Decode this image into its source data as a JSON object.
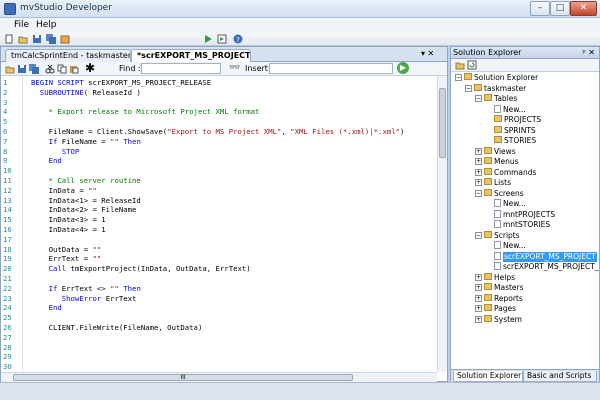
{
  "app": {
    "title": "mvStudio Developer"
  },
  "window_controls": {
    "minimize": "–",
    "maximize": "□",
    "close": "✕"
  },
  "menu": {
    "items": [
      "File",
      "Help"
    ]
  },
  "main_toolbar": {
    "icons": [
      "new-icon",
      "open-icon",
      "save-icon",
      "save-all-icon",
      "deploy-icon",
      "run-icon",
      "debug-icon",
      "help-icon"
    ]
  },
  "document": {
    "tabs": [
      {
        "label": "tmCalcSprintEnd - taskmaster.bp"
      },
      {
        "label": "*scrEXPORT_MS_PROJECT_REL..."
      }
    ],
    "tab_controls": "▾ ✕",
    "toolbar": {
      "find_label": "Find :",
      "insert_label": "Insert :"
    },
    "code_lines": [
      {
        "n": "1",
        "parts": [
          {
            "t": "kw",
            "v": "BEGIN SCRIPT"
          },
          {
            "t": "nm",
            "v": " scrEXPORT_MS_PROJECT_RELEASE"
          }
        ]
      },
      {
        "n": "2",
        "parts": [
          {
            "t": "nm",
            "v": "  "
          },
          {
            "t": "kw",
            "v": "SUBROUTINE"
          },
          {
            "t": "nm",
            "v": "( ReleaseId )"
          }
        ]
      },
      {
        "n": "3",
        "parts": []
      },
      {
        "n": "4",
        "parts": [
          {
            "t": "cm",
            "v": "    * Export release to Microsoft Project XML format"
          }
        ]
      },
      {
        "n": "5",
        "parts": []
      },
      {
        "n": "6",
        "parts": [
          {
            "t": "nm",
            "v": "    FileName = Client.ShowSave("
          },
          {
            "t": "st",
            "v": "\"Export to MS Project XML\""
          },
          {
            "t": "nm",
            "v": ", "
          },
          {
            "t": "st",
            "v": "\"XML Files (*.xml)|*.xml\""
          },
          {
            "t": "nm",
            "v": ")"
          }
        ]
      },
      {
        "n": "7",
        "parts": [
          {
            "t": "kw",
            "v": "    If"
          },
          {
            "t": "nm",
            "v": " FileName = "
          },
          {
            "t": "st",
            "v": "\"\""
          },
          {
            "t": "kw",
            "v": " Then"
          }
        ]
      },
      {
        "n": "8",
        "parts": [
          {
            "t": "kw",
            "v": "       STOP"
          }
        ]
      },
      {
        "n": "9",
        "parts": [
          {
            "t": "kw",
            "v": "    End"
          }
        ]
      },
      {
        "n": "10",
        "parts": []
      },
      {
        "n": "11",
        "parts": [
          {
            "t": "cm",
            "v": "    * Call server routine"
          }
        ]
      },
      {
        "n": "12",
        "parts": [
          {
            "t": "nm",
            "v": "    InData = "
          },
          {
            "t": "st",
            "v": "\"\""
          }
        ]
      },
      {
        "n": "13",
        "parts": [
          {
            "t": "nm",
            "v": "    InData<1> = ReleaseId"
          }
        ]
      },
      {
        "n": "14",
        "parts": [
          {
            "t": "nm",
            "v": "    InData<2> = FileName"
          }
        ]
      },
      {
        "n": "15",
        "parts": [
          {
            "t": "nm",
            "v": "    InData<3> = 1"
          }
        ]
      },
      {
        "n": "16",
        "parts": [
          {
            "t": "nm",
            "v": "    InData<4> = 1"
          }
        ]
      },
      {
        "n": "17",
        "parts": []
      },
      {
        "n": "18",
        "parts": [
          {
            "t": "nm",
            "v": "    OutData = "
          },
          {
            "t": "st",
            "v": "\"\""
          }
        ]
      },
      {
        "n": "19",
        "parts": [
          {
            "t": "nm",
            "v": "    ErrText = "
          },
          {
            "t": "st",
            "v": "\"\""
          }
        ]
      },
      {
        "n": "20",
        "parts": [
          {
            "t": "kw",
            "v": "    Call"
          },
          {
            "t": "nm",
            "v": " tmExportProject(InData, OutData, ErrText)"
          }
        ]
      },
      {
        "n": "21",
        "parts": []
      },
      {
        "n": "22",
        "parts": [
          {
            "t": "kw",
            "v": "    If"
          },
          {
            "t": "nm",
            "v": " ErrText <> "
          },
          {
            "t": "st",
            "v": "\"\""
          },
          {
            "t": "kw",
            "v": " Then"
          }
        ]
      },
      {
        "n": "23",
        "parts": [
          {
            "t": "kw",
            "v": "       ShowError"
          },
          {
            "t": "nm",
            "v": " ErrText"
          }
        ]
      },
      {
        "n": "24",
        "parts": [
          {
            "t": "kw",
            "v": "    End"
          }
        ]
      },
      {
        "n": "25",
        "parts": []
      },
      {
        "n": "26",
        "parts": [
          {
            "t": "nm",
            "v": "    CLIENT.FileWrite(FileName, OutData)"
          }
        ]
      },
      {
        "n": "27",
        "parts": []
      },
      {
        "n": "28",
        "parts": []
      },
      {
        "n": "29",
        "parts": []
      },
      {
        "n": "30",
        "parts": []
      }
    ],
    "hscroll_grip": "III"
  },
  "solution_explorer": {
    "title": "Solution Explorer",
    "title_controls": "ᵖ ✕",
    "tree": [
      {
        "label": "Solution Explorer",
        "level": 0,
        "exp": "−",
        "icon": "solution"
      },
      {
        "label": "taskmaster",
        "level": 1,
        "exp": "−",
        "icon": "project"
      },
      {
        "label": "Tables",
        "level": 2,
        "exp": "−",
        "icon": "folder"
      },
      {
        "label": "New...",
        "level": 3,
        "exp": "",
        "icon": "page"
      },
      {
        "label": "PROJECTS",
        "level": 3,
        "exp": "",
        "icon": "folder"
      },
      {
        "label": "SPRINTS",
        "level": 3,
        "exp": "",
        "icon": "folder"
      },
      {
        "label": "STORIES",
        "level": 3,
        "exp": "",
        "icon": "folder"
      },
      {
        "label": "Views",
        "level": 2,
        "exp": "+",
        "icon": "folder"
      },
      {
        "label": "Menus",
        "level": 2,
        "exp": "+",
        "icon": "folder"
      },
      {
        "label": "Commands",
        "level": 2,
        "exp": "+",
        "icon": "folder"
      },
      {
        "label": "Lists",
        "level": 2,
        "exp": "+",
        "icon": "folder"
      },
      {
        "label": "Screens",
        "level": 2,
        "exp": "−",
        "icon": "folder"
      },
      {
        "label": "New...",
        "level": 3,
        "exp": "",
        "icon": "page"
      },
      {
        "label": "mntPROJECTS",
        "level": 3,
        "exp": "",
        "icon": "page"
      },
      {
        "label": "mntSTORIES",
        "level": 3,
        "exp": "",
        "icon": "page"
      },
      {
        "label": "Scripts",
        "level": 2,
        "exp": "−",
        "icon": "folder"
      },
      {
        "label": "New...",
        "level": 3,
        "exp": "",
        "icon": "page"
      },
      {
        "label": "scrEXPORT_MS_PROJECT",
        "level": 3,
        "exp": "",
        "icon": "page",
        "selected": true
      },
      {
        "label": "scrEXPORT_MS_PROJECT_R",
        "level": 3,
        "exp": "",
        "icon": "page"
      },
      {
        "label": "Helps",
        "level": 2,
        "exp": "+",
        "icon": "folder"
      },
      {
        "label": "Masters",
        "level": 2,
        "exp": "+",
        "icon": "folder"
      },
      {
        "label": "Reports",
        "level": 2,
        "exp": "+",
        "icon": "folder"
      },
      {
        "label": "Pages",
        "level": 2,
        "exp": "+",
        "icon": "folder"
      },
      {
        "label": "System",
        "level": 2,
        "exp": "+",
        "icon": "folder"
      }
    ],
    "bottom_tabs": [
      {
        "label": "Solution Explorer"
      },
      {
        "label": "Basic and Scripts"
      }
    ]
  }
}
